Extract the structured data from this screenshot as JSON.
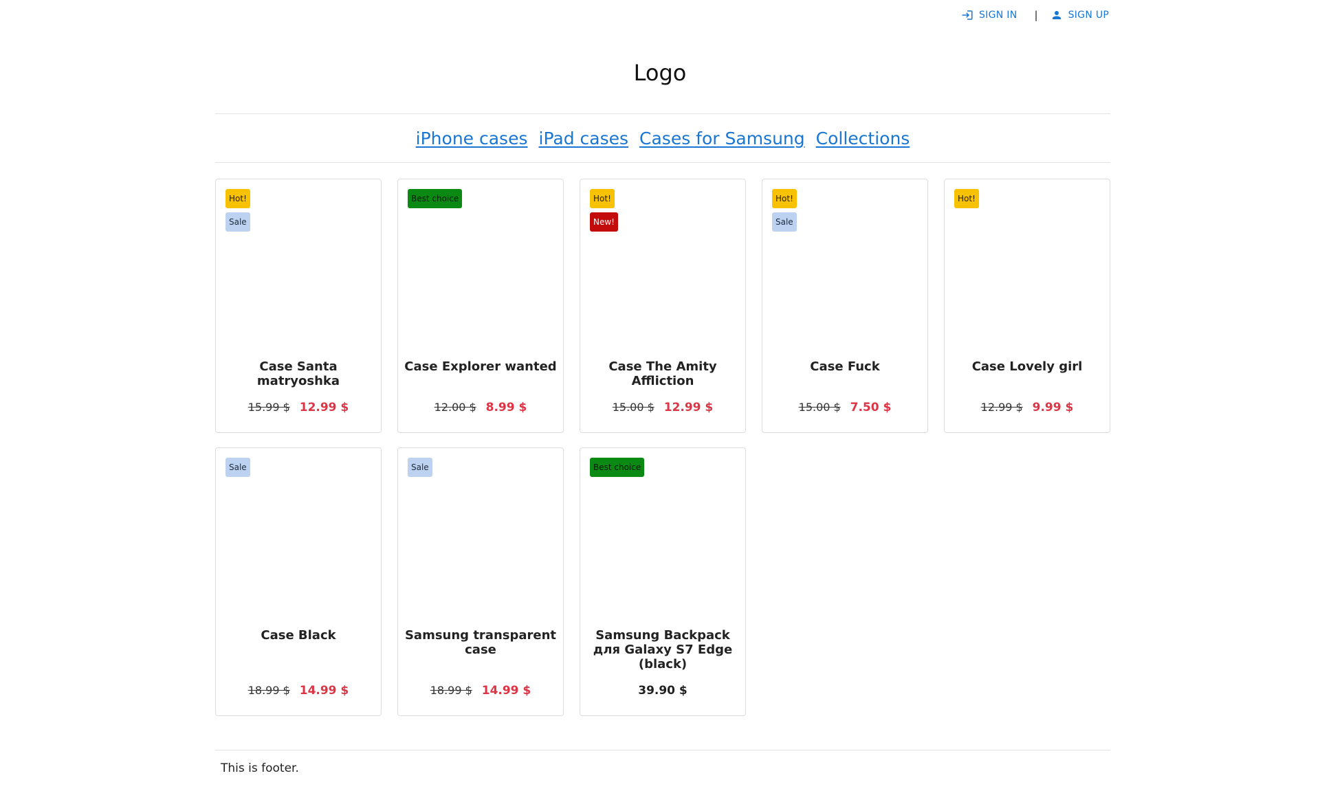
{
  "header": {
    "sign_in_label": "SIGN IN",
    "sign_up_label": "SIGN UP",
    "separator": "|",
    "logo_text": "Logo"
  },
  "nav": {
    "items": [
      {
        "label": "iPhone cases"
      },
      {
        "label": "iPad cases"
      },
      {
        "label": "Cases for Samsung"
      },
      {
        "label": "Collections"
      }
    ]
  },
  "products": [
    {
      "title": "Case Santa matryoshka",
      "badges": [
        {
          "text": "Hot!",
          "kind": "hot"
        },
        {
          "text": "Sale",
          "kind": "sale"
        }
      ],
      "old_price": "15.99 $",
      "price": "12.99 $"
    },
    {
      "title": "Case Explorer wanted",
      "badges": [
        {
          "text": "Best choice",
          "kind": "best"
        }
      ],
      "old_price": "12.00 $",
      "price": "8.99 $"
    },
    {
      "title": "Case The Amity Affliction",
      "badges": [
        {
          "text": "Hot!",
          "kind": "hot"
        },
        {
          "text": "New!",
          "kind": "new"
        }
      ],
      "old_price": "15.00 $",
      "price": "12.99 $"
    },
    {
      "title": "Case Fuck",
      "badges": [
        {
          "text": "Hot!",
          "kind": "hot"
        },
        {
          "text": "Sale",
          "kind": "sale"
        }
      ],
      "old_price": "15.00 $",
      "price": "7.50 $"
    },
    {
      "title": "Case Lovely girl",
      "badges": [
        {
          "text": "Hot!",
          "kind": "hot"
        }
      ],
      "old_price": "12.99 $",
      "price": "9.99 $"
    },
    {
      "title": "Case Black",
      "badges": [
        {
          "text": "Sale",
          "kind": "sale"
        }
      ],
      "old_price": "18.99 $",
      "price": "14.99 $"
    },
    {
      "title": "Samsung transparent case",
      "badges": [
        {
          "text": "Sale",
          "kind": "sale"
        }
      ],
      "old_price": "18.99 $",
      "price": "14.99 $"
    },
    {
      "title": "Samsung Backpack для Galaxy S7 Edge (black)",
      "badges": [
        {
          "text": "Best choice",
          "kind": "best"
        }
      ],
      "old_price": "",
      "price": "39.90 $"
    }
  ],
  "footer": {
    "text": "This is footer."
  },
  "colors": {
    "link": "#1976d2",
    "sale_price": "#dc3545",
    "badge_hot": "#f9c200",
    "badge_sale": "#bcd2f0",
    "badge_best": "#0a8a12",
    "badge_new": "#c40b0b"
  }
}
